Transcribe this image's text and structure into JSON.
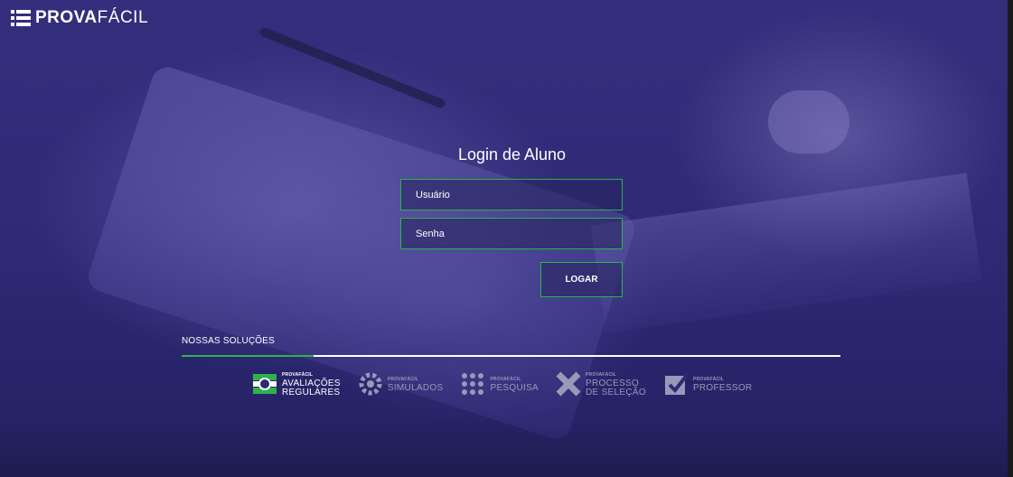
{
  "logo": {
    "strong": "PROVA",
    "light": "FÁCIL"
  },
  "login": {
    "title": "Login de Aluno",
    "user_placeholder": "Usuário",
    "pass_placeholder": "Senha",
    "button_label": "LOGAR"
  },
  "solutions": {
    "title": "NOSSAS SOLUÇÕES",
    "items": [
      {
        "brand": "PROVAFÁCIL",
        "line1": "AVALIAÇÕES",
        "line2": "REGULARES",
        "icon": "avaliacoes-icon",
        "active": true
      },
      {
        "brand": "PROVAFÁCIL",
        "line1": "SIMULADOS",
        "line2": "",
        "icon": "simulados-icon",
        "active": false
      },
      {
        "brand": "PROVAFÁCIL",
        "line1": "PESQUISA",
        "line2": "",
        "icon": "pesquisa-icon",
        "active": false
      },
      {
        "brand": "PROVAFÁCIL",
        "line1": "PROCESSO",
        "line2": "DE SELEÇÃO",
        "icon": "processo-icon",
        "active": false
      },
      {
        "brand": "PROVAFÁCIL",
        "line1": "PROFESSOR",
        "line2": "",
        "icon": "professor-icon",
        "active": false
      }
    ]
  },
  "colors": {
    "accent": "#2fb24a",
    "background": "#2d2a72"
  }
}
